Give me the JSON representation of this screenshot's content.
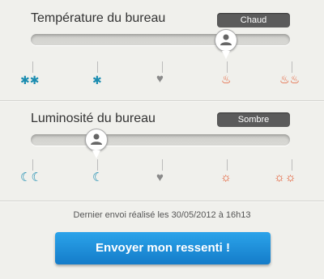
{
  "temperature": {
    "title": "Température du bureau",
    "badge": "Chaud",
    "level": 0.78,
    "icons": [
      "snowflake-double-icon",
      "snowflake-icon",
      "heart-icon",
      "flame-icon",
      "flame-double-icon"
    ],
    "colors": {
      "cold": "#1a8cb0",
      "neutral": "#8a8a8a",
      "hot": "#e14a1e"
    }
  },
  "luminosity": {
    "title": "Luminosité du bureau",
    "badge": "Sombre",
    "level": 0.25,
    "icons": [
      "moon-double-icon",
      "moon-icon",
      "heart-icon",
      "sun-icon",
      "sun-double-icon"
    ],
    "colors": {
      "dark": "#1a8cb0",
      "neutral": "#8a8a8a",
      "bright": "#e14a1e"
    }
  },
  "footer": {
    "last_sent": "Dernier envoi réalisé les 30/05/2012 à 16h13"
  },
  "actions": {
    "send_label": "Envoyer mon ressenti !"
  },
  "accent_color": "#1a8ad8"
}
